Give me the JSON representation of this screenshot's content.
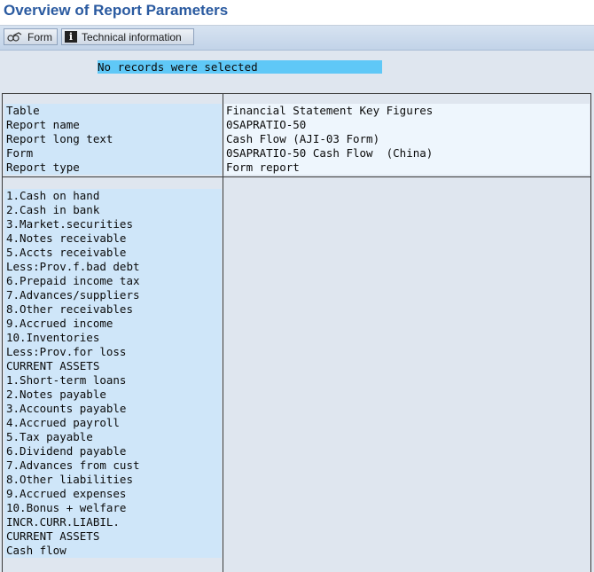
{
  "header": {
    "title": "Overview of Report Parameters"
  },
  "toolbar": {
    "form_label": "Form",
    "tech_info_label": "Technical information"
  },
  "message": "No records were selected",
  "params": [
    {
      "label": "Table",
      "value": "Financial Statement Key Figures"
    },
    {
      "label": "Report name",
      "value": "0SAPRATIO-50"
    },
    {
      "label": "Report long text",
      "value": "Cash Flow (AJI-03 Form)"
    },
    {
      "label": "Form",
      "value": "0SAPRATIO-50 Cash Flow  (China)"
    },
    {
      "label": "Report type",
      "value": "Form report"
    }
  ],
  "rows": [
    "1.Cash on hand",
    "2.Cash in bank",
    "3.Market.securities",
    "4.Notes receivable",
    "5.Accts receivable",
    "Less:Prov.f.bad debt",
    "6.Prepaid income tax",
    "7.Advances/suppliers",
    "8.Other receivables",
    "9.Accrued income",
    "10.Inventories",
    "Less:Prov.for loss",
    "CURRENT ASSETS",
    "1.Short-term loans",
    "2.Notes payable",
    "3.Accounts payable",
    "4.Accrued payroll",
    "5.Tax payable",
    "6.Dividend payable",
    "7.Advances from cust",
    "8.Other liabilities",
    "9.Accrued expenses",
    "10.Bonus + welfare",
    "INCR.CURR.LIABIL.",
    "CURRENT ASSETS",
    "Cash flow"
  ]
}
